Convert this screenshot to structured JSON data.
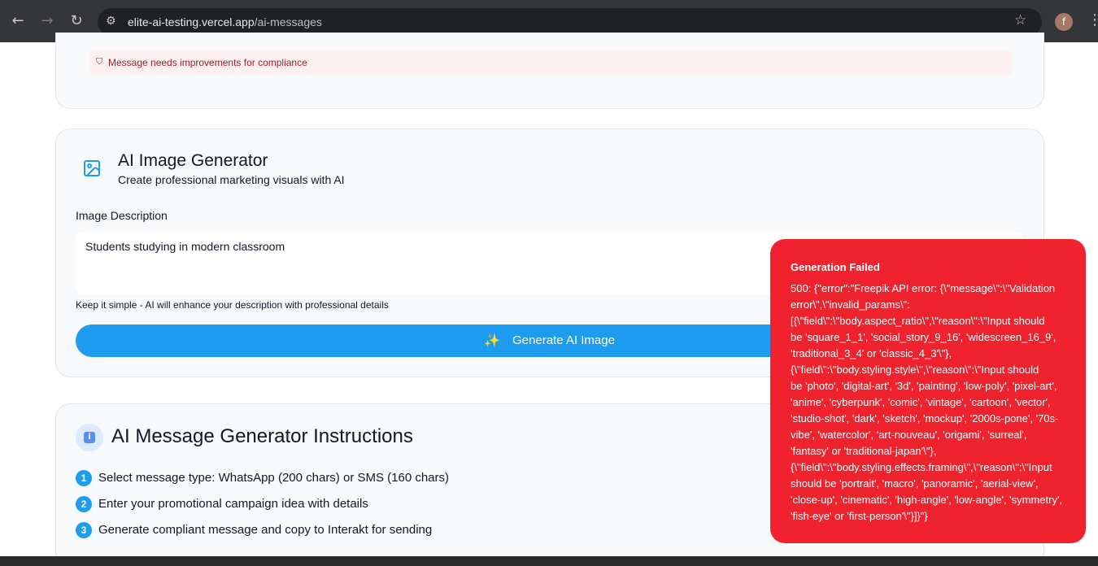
{
  "browser": {
    "url_host": "elite-ai-testing.vercel.app",
    "url_path": "/ai-messages",
    "profile_initial": "f"
  },
  "compliance": {
    "text": "Message needs improvements for compliance"
  },
  "image_generator": {
    "title": "AI Image Generator",
    "subtitle": "Create professional marketing visuals with AI",
    "description_label": "Image Description",
    "description_value": "Students studying in modern classroom",
    "hint": "Keep it simple - AI will enhance your description with professional details",
    "button_label": "Generate AI Image"
  },
  "instructions": {
    "title": "AI Message Generator Instructions",
    "steps": [
      {
        "num": "1",
        "text": "Select message type: WhatsApp (200 chars) or SMS (160 chars)"
      },
      {
        "num": "2",
        "text": "Enter your promotional campaign idea with details"
      },
      {
        "num": "3",
        "text": "Generate compliant message and copy to Interakt for sending"
      }
    ]
  },
  "toast": {
    "title": "Generation Failed",
    "body": "500: {\"error\":\"Freepik API error: {\\\"message\\\":\\\"Validation\nerror\\\",\\\"invalid_params\\\":\n[{\\\"field\\\":\\\"body.aspect_ratio\\\",\\\"reason\\\":\\\"Input should\nbe 'square_1_1', 'social_story_9_16', 'widescreen_16_9',\n'traditional_3_4' or 'classic_4_3'\\\"},\n{\\\"field\\\":\\\"body.styling.style\\\",\\\"reason\\\":\\\"Input should\nbe 'photo', 'digital-art', '3d', 'painting', 'low-poly', 'pixel-art',\n'anime', 'cyberpunk', 'comic', 'vintage', 'cartoon', 'vector',\n'studio-shot', 'dark', 'sketch', 'mockup', '2000s-pone', '70s-\nvibe', 'watercolor', 'art-nouveau', 'origami', 'surreal',\n'fantasy' or 'traditional-japan'\\\"},\n{\\\"field\\\":\\\"body.styling.effects.framing\\\",\\\"reason\\\":\\\"Input\nshould be 'portrait', 'macro', 'panoramic', 'aerial-view',\n'close-up', 'cinematic', 'high-angle', 'low-angle', 'symmetry',\n'fish-eye' or 'first-person'\\\"}]}\"}"
  },
  "colors": {
    "accent": "#1e9cf0",
    "error": "#f0222e",
    "card_bg": "#f8f9fa"
  }
}
